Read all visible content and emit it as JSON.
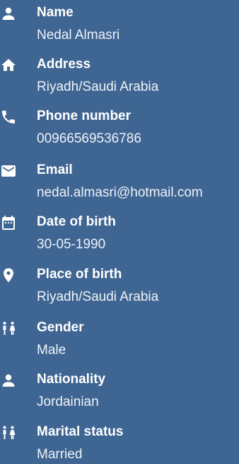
{
  "items": [
    {
      "icon": "person-icon",
      "label": "Name",
      "value": "Nedal Almasri"
    },
    {
      "icon": "home-icon",
      "label": "Address",
      "value": "Riyadh/Saudi Arabia"
    },
    {
      "icon": "phone-icon",
      "label": "Phone number",
      "value": "00966569536786"
    },
    {
      "icon": "email-icon",
      "label": "Email",
      "value": "nedal.almasri@hotmail.com"
    },
    {
      "icon": "calendar-icon",
      "label": "Date of birth",
      "value": "30-05-1990"
    },
    {
      "icon": "location-pin-icon",
      "label": "Place of birth",
      "value": "Riyadh/Saudi Arabia"
    },
    {
      "icon": "wc-icon",
      "label": "Gender",
      "value": "Male"
    },
    {
      "icon": "person-icon",
      "label": "Nationality",
      "value": "Jordainian"
    },
    {
      "icon": "wc-icon",
      "label": "Marital status",
      "value": "Married"
    }
  ]
}
